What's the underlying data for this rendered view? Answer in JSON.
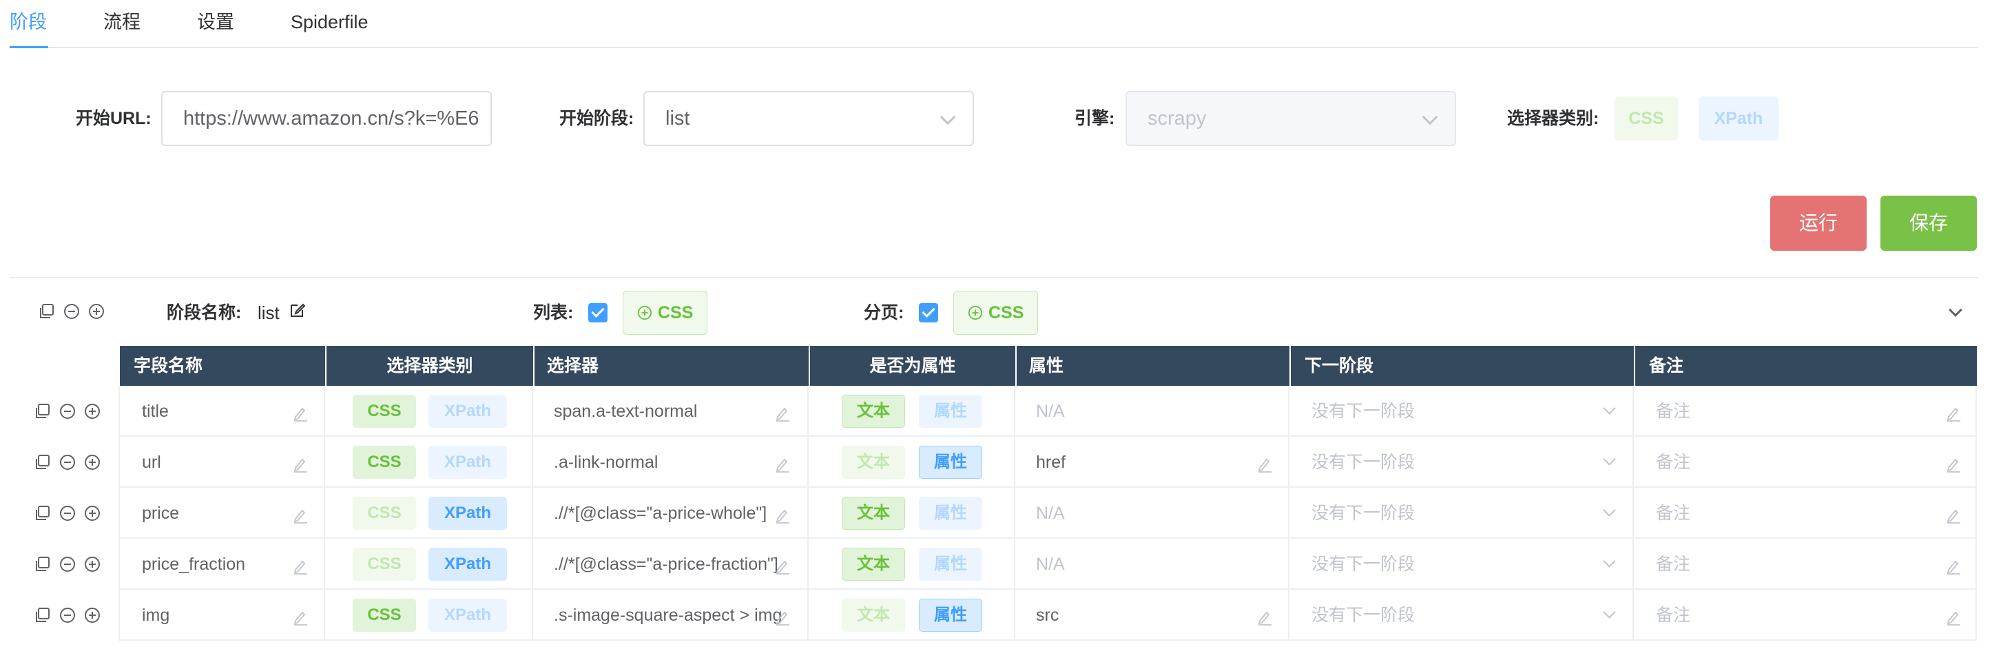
{
  "tabs": [
    {
      "label": "阶段",
      "active": true
    },
    {
      "label": "流程",
      "active": false
    },
    {
      "label": "设置",
      "active": false
    },
    {
      "label": "Spiderfile",
      "active": false
    }
  ],
  "config": {
    "start_url_label": "开始URL:",
    "start_url_value": "https://www.amazon.cn/s?k=%E6",
    "start_stage_label": "开始阶段:",
    "start_stage_value": "list",
    "engine_label": "引擎:",
    "engine_value": "scrapy",
    "selector_type_label": "选择器类别:",
    "selector_css": "CSS",
    "selector_xpath": "XPath"
  },
  "actions": {
    "run_label": "运行",
    "save_label": "保存"
  },
  "stage": {
    "name_label": "阶段名称:",
    "name_value": "list",
    "list_label": "列表:",
    "list_checked": true,
    "list_css_label": "CSS",
    "page_label": "分页:",
    "page_checked": true,
    "page_css_label": "CSS"
  },
  "table": {
    "headers": [
      "字段名称",
      "选择器类别",
      "选择器",
      "是否为属性",
      "属性",
      "下一阶段",
      "备注"
    ],
    "css_label": "CSS",
    "xpath_label": "XPath",
    "text_label": "文本",
    "attr_label": "属性",
    "next_stage_placeholder": "没有下一阶段",
    "remark_placeholder": "备注",
    "attr_placeholder": "N/A",
    "rows": [
      {
        "name": "title",
        "selector_type": "CSS",
        "selector": "span.a-text-normal",
        "is_attr": false,
        "attr": "N/A"
      },
      {
        "name": "url",
        "selector_type": "CSS",
        "selector": ".a-link-normal",
        "is_attr": true,
        "attr": "href"
      },
      {
        "name": "price",
        "selector_type": "XPath",
        "selector": ".//*[@class=\"a-price-whole\"]",
        "is_attr": false,
        "attr": "N/A"
      },
      {
        "name": "price_fraction",
        "selector_type": "XPath",
        "selector": ".//*[@class=\"a-price-fraction\"]",
        "is_attr": false,
        "attr": "N/A"
      },
      {
        "name": "img",
        "selector_type": "CSS",
        "selector": ".s-image-square-aspect > img",
        "is_attr": true,
        "attr": "src"
      }
    ]
  },
  "colors": {
    "primary": "#409eff",
    "success": "#67c23a",
    "danger_button": "#e57373",
    "save_button": "#79c147",
    "table_header": "#34495e"
  }
}
